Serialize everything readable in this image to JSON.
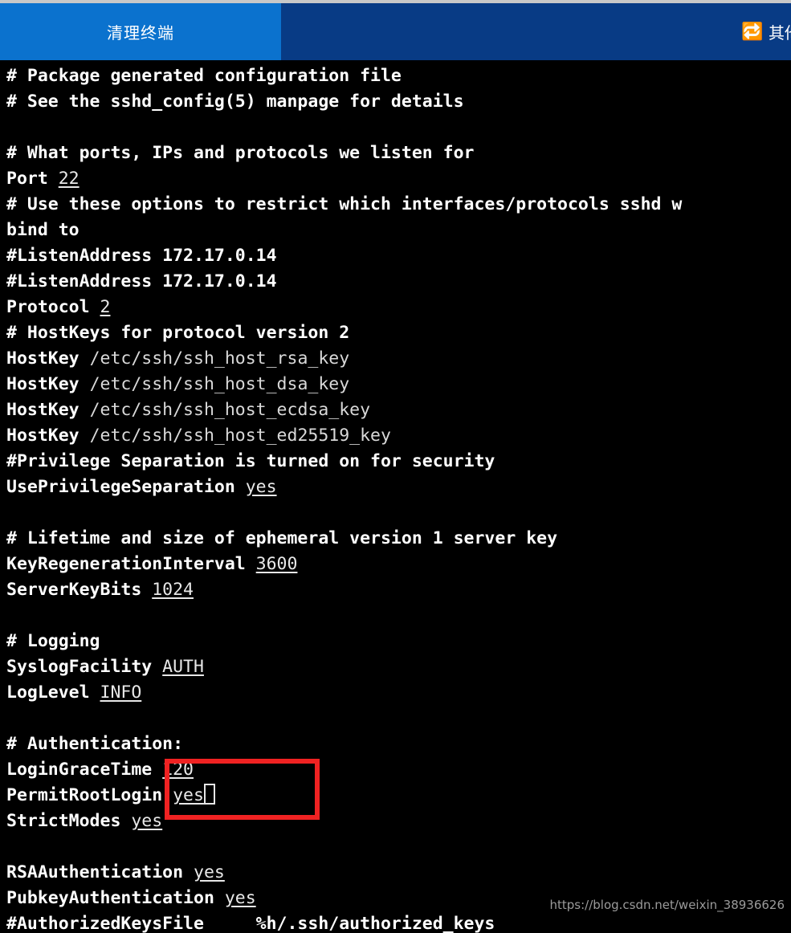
{
  "header": {
    "tab_label": "清理终端",
    "other_login_label": "其他登录",
    "other_login_icon": "swap-arrows-icon",
    "tab_bg": "#0b72ce",
    "bar_bg": "#083b85"
  },
  "terminal": {
    "background": "#000000",
    "foreground": "#ffffff",
    "lines": [
      {
        "type": "comment",
        "text": "# Package generated configuration file"
      },
      {
        "type": "comment",
        "text": "# See the sshd_config(5) manpage for details"
      },
      {
        "type": "blank",
        "text": ""
      },
      {
        "type": "comment",
        "text": "# What ports, IPs and protocols we listen for"
      },
      {
        "type": "directive",
        "key": "Port",
        "value": "22"
      },
      {
        "type": "comment",
        "text": "# Use these options to restrict which interfaces/protocols sshd w"
      },
      {
        "type": "comment",
        "text": "bind to"
      },
      {
        "type": "comment",
        "text": "#ListenAddress 172.17.0.14"
      },
      {
        "type": "comment",
        "text": "#ListenAddress 172.17.0.14"
      },
      {
        "type": "directive",
        "key": "Protocol",
        "value": "2"
      },
      {
        "type": "comment",
        "text": "# HostKeys for protocol version 2"
      },
      {
        "type": "path",
        "key": "HostKey",
        "value": "/etc/ssh/ssh_host_rsa_key"
      },
      {
        "type": "path",
        "key": "HostKey",
        "value": "/etc/ssh/ssh_host_dsa_key"
      },
      {
        "type": "path",
        "key": "HostKey",
        "value": "/etc/ssh/ssh_host_ecdsa_key"
      },
      {
        "type": "path",
        "key": "HostKey",
        "value": "/etc/ssh/ssh_host_ed25519_key"
      },
      {
        "type": "comment",
        "text": "#Privilege Separation is turned on for security"
      },
      {
        "type": "directive",
        "key": "UsePrivilegeSeparation",
        "value": "yes"
      },
      {
        "type": "blank",
        "text": ""
      },
      {
        "type": "comment",
        "text": "# Lifetime and size of ephemeral version 1 server key"
      },
      {
        "type": "directive",
        "key": "KeyRegenerationInterval",
        "value": "3600"
      },
      {
        "type": "directive",
        "key": "ServerKeyBits",
        "value": "1024"
      },
      {
        "type": "blank",
        "text": ""
      },
      {
        "type": "comment",
        "text": "# Logging"
      },
      {
        "type": "directive",
        "key": "SyslogFacility",
        "value": "AUTH"
      },
      {
        "type": "directive",
        "key": "LogLevel",
        "value": "INFO"
      },
      {
        "type": "blank",
        "text": ""
      },
      {
        "type": "comment",
        "text": "# Authentication:"
      },
      {
        "type": "directive",
        "key": "LoginGraceTime",
        "value": "120"
      },
      {
        "type": "directive",
        "key": "PermitRootLogin",
        "value": "yes",
        "cursor": true
      },
      {
        "type": "directive",
        "key": "StrictModes",
        "value": "yes"
      },
      {
        "type": "blank",
        "text": ""
      },
      {
        "type": "directive",
        "key": "RSAAuthentication",
        "value": "yes"
      },
      {
        "type": "directive",
        "key": "PubkeyAuthentication",
        "value": "yes"
      },
      {
        "type": "comment",
        "text": "#AuthorizedKeysFile     %h/.ssh/authorized_keys"
      }
    ]
  },
  "annotation": {
    "color": "#f02222",
    "target": "PermitRootLogin yes"
  },
  "watermark": {
    "text": "https://blog.csdn.net/weixin_38936626"
  }
}
